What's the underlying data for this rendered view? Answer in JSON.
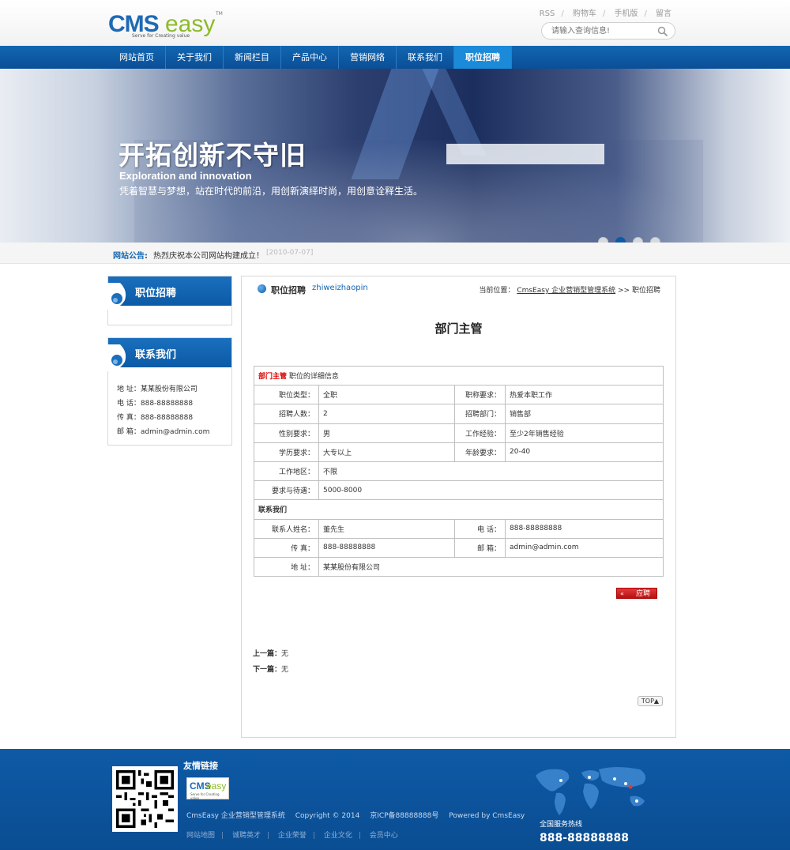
{
  "header": {
    "logo_main": "CMS",
    "logo_accent": "easy",
    "logo_tm": "TM",
    "logo_slogan": "Serve for Creating value",
    "toplinks": [
      "RSS",
      "购物车",
      "手机版",
      "留言"
    ],
    "search_placeholder": "请输入查询信息!"
  },
  "nav": {
    "items": [
      "网站首页",
      "关于我们",
      "新闻栏目",
      "产品中心",
      "营销网络",
      "联系我们",
      "职位招聘"
    ],
    "active_index": 6
  },
  "banner": {
    "title": "开拓创新不守旧",
    "subtitle_en": "Exploration and innovation",
    "subtitle_cn": "凭着智慧与梦想，站在时代的前沿，用创新演绎时尚，用创意诠释生活。",
    "slide_count": 4,
    "active_slide": 2
  },
  "notice": {
    "label": "网站公告:",
    "text": "热烈庆祝本公司网站构建成立！",
    "date": "[2010-07-07]"
  },
  "sidebar": {
    "box1_title": "职位招聘",
    "box2_title": "联系我们",
    "contact": {
      "address": "地 址：某某股份有限公司",
      "phone": "电 话：888-88888888",
      "fax": "传 真：888-88888888",
      "email": "邮 箱：admin@admin.com"
    }
  },
  "main": {
    "section_title": "职位招聘",
    "section_title_en": "zhiweizhaopin",
    "breadcrumb_prefix": "当前位置：",
    "breadcrumb_link": "CmsEasy 企业营销型管理系统",
    "breadcrumb_sep": ">>",
    "breadcrumb_current": "职位招聘",
    "job_title": "部门主管",
    "detail_head_red": "部门主管",
    "detail_head_rest": "职位的详细信息",
    "rows": {
      "type_k": "职位类型：",
      "type_v": "全职",
      "title_k": "职称要求：",
      "title_v": "热爱本职工作",
      "count_k": "招聘人数：",
      "count_v": "2",
      "dept_k": "招聘部门：",
      "dept_v": "销售部",
      "sex_k": "性别要求：",
      "sex_v": "男",
      "exp_k": "工作经验：",
      "exp_v": "至少2年销售经验",
      "edu_k": "学历要求：",
      "edu_v": "大专以上",
      "age_k": "年龄要求：",
      "age_v": "20-40",
      "area_k": "工作地区：",
      "area_v": "不限",
      "salary_k": "要求与待遇：",
      "salary_v": "5000-8000"
    },
    "contact_head": "联系我们",
    "contact_rows": {
      "name_k": "联系人姓名：",
      "name_v": "董先生",
      "phone_k": "电 话：",
      "phone_v": "888-88888888",
      "fax_k": "传 真：",
      "fax_v": "888-88888888",
      "mail_k": "邮 箱：",
      "mail_v": "admin@admin.com",
      "addr_k": "地 址：",
      "addr_v": "某某股份有限公司"
    },
    "apply_label": "应聘",
    "apply_arrow": "«",
    "prev_label": "上一篇：",
    "prev_value": "无",
    "next_label": "下一篇：",
    "next_value": "无",
    "top_label": "TOP▲"
  },
  "footer": {
    "links_title": "友情链接",
    "flogo_main": "CMS",
    "flogo_accent": "easy",
    "flogo_slogan": "Serve for Creating value",
    "copyright": [
      "CmsEasy 企业营销型管理系统",
      "Copyright © 2014",
      "京ICP备88888888号",
      "Powered by CmsEasy"
    ],
    "bottom_links": [
      "网站地图",
      "诚聘英才",
      "企业荣誉",
      "企业文化",
      "会员中心"
    ],
    "hotline_label": "全国服务热线",
    "hotline": "888-88888888"
  }
}
